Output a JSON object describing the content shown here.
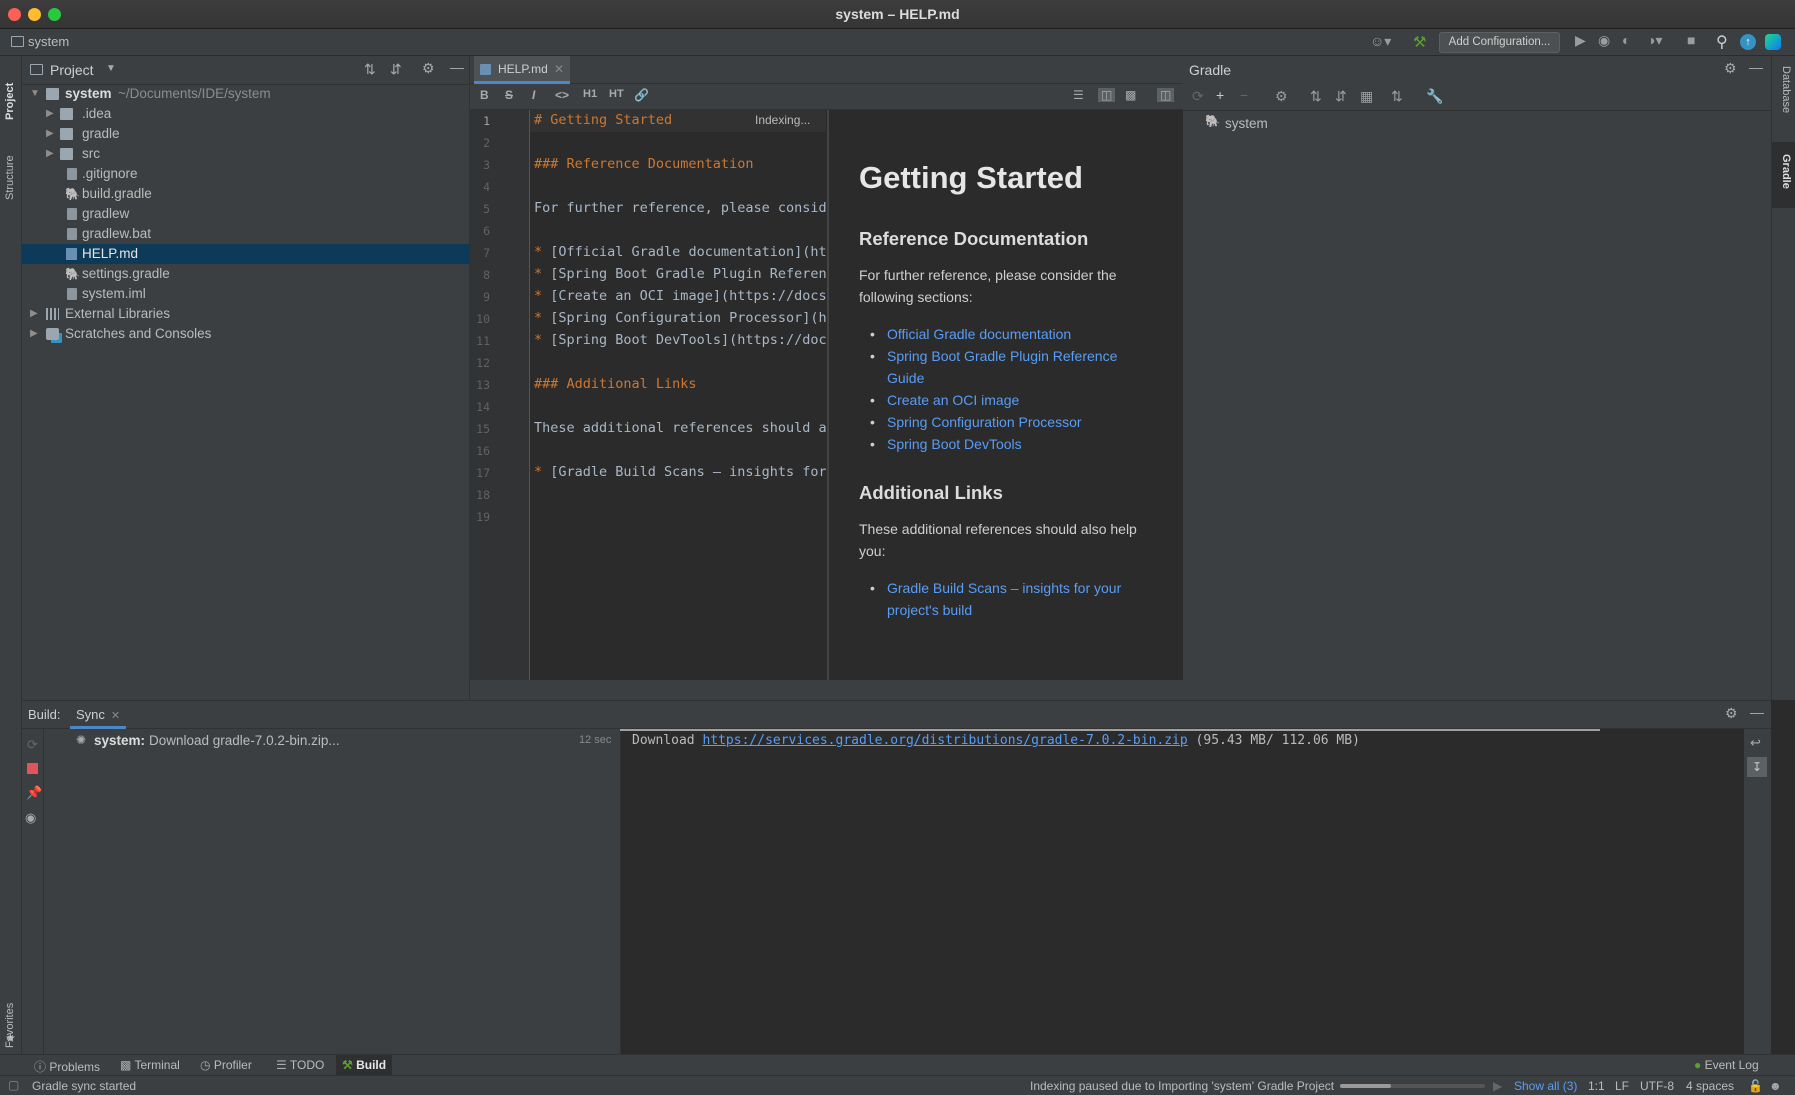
{
  "window": {
    "title": "system – HELP.md"
  },
  "navbar": {
    "crumb": "system",
    "add_config": "Add Configuration..."
  },
  "left_strip": {
    "project": "Project",
    "structure": "Structure",
    "favorites": "Favorites"
  },
  "right_strip": {
    "database": "Database",
    "gradle": "Gradle"
  },
  "project": {
    "header": "Project",
    "root_name": "system",
    "root_path": "~/Documents/IDE/system",
    "items": [
      {
        "label": ".idea"
      },
      {
        "label": "gradle"
      },
      {
        "label": "src"
      },
      {
        "label": ".gitignore"
      },
      {
        "label": "build.gradle"
      },
      {
        "label": "gradlew"
      },
      {
        "label": "gradlew.bat"
      },
      {
        "label": "HELP.md"
      },
      {
        "label": "settings.gradle"
      },
      {
        "label": "system.iml"
      },
      {
        "label": "External Libraries"
      },
      {
        "label": "Scratches and Consoles"
      }
    ]
  },
  "editor": {
    "tab": "HELP.md",
    "indexing": "Indexing...",
    "toolbar": {
      "bold": "B",
      "strike": "S",
      "italic": "I",
      "code": "<>",
      "h1": "H1",
      "ht": "HT"
    },
    "line_numbers": [
      "1",
      "2",
      "3",
      "4",
      "5",
      "6",
      "7",
      "8",
      "9",
      "10",
      "11",
      "12",
      "13",
      "14",
      "15",
      "16",
      "17",
      "18",
      "19"
    ],
    "lines": [
      "# Getting Started",
      "",
      "### Reference Documentation",
      "",
      "For further reference, please conside",
      "",
      "* [Official Gradle documentation](ht",
      "* [Spring Boot Gradle Plugin Referen",
      "* [Create an OCI image](https://docs",
      "* [Spring Configuration Processor](h",
      "* [Spring Boot DevTools](https://docs",
      "",
      "### Additional Links",
      "",
      "These additional references should a",
      "",
      "* [Gradle Build Scans – insights for",
      "",
      ""
    ]
  },
  "preview": {
    "h1": "Getting Started",
    "h2_ref": "Reference Documentation",
    "p_ref": "For further reference, please consider the following sections:",
    "ref_links": [
      "Official Gradle documentation",
      "Spring Boot Gradle Plugin Reference Guide",
      "Create an OCI image",
      "Spring Configuration Processor",
      "Spring Boot DevTools"
    ],
    "h2_add": "Additional Links",
    "p_add": "These additional references should also help you:",
    "add_links": [
      "Gradle Build Scans – insights for your project's build"
    ]
  },
  "gradle": {
    "header": "Gradle",
    "root": "system"
  },
  "build": {
    "label": "Build:",
    "tab": "Sync",
    "task_name": "system:",
    "task_text": "Download gradle-7.0.2-bin.zip...",
    "task_time": "12 sec",
    "console_prefix": "Download",
    "console_url": "https://services.gradle.org/distributions/gradle-7.0.2-bin.zip",
    "console_suffix": "(95.43 MB/ 112.06 MB)"
  },
  "bottom_tabs": {
    "problems": "Problems",
    "terminal": "Terminal",
    "profiler": "Profiler",
    "todo": "TODO",
    "build": "Build",
    "event_log": "Event Log"
  },
  "status": {
    "left": "Gradle sync started",
    "indexing": "Indexing paused due to Importing 'system' Gradle Project",
    "show_all": "Show all (3)",
    "pos": "1:1",
    "lf": "LF",
    "enc": "UTF-8",
    "indent": "4 spaces",
    "progress": 0.35
  },
  "colors": {
    "accent": "#4a88c7",
    "link": "#589df6",
    "selection": "#0d3a58",
    "stop": "#e05555",
    "build_icon": "#5aa02c"
  }
}
